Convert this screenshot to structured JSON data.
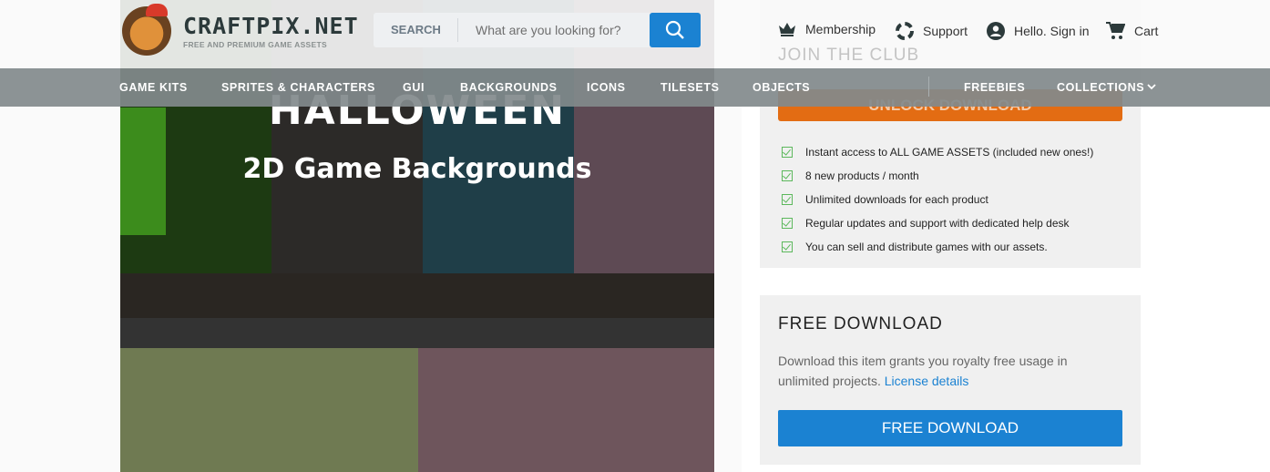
{
  "header": {
    "logo_text": "CRAFTPIX.NET",
    "logo_tagline": "FREE AND PREMIUM GAME ASSETS",
    "search": {
      "label": "SEARCH",
      "placeholder": "What are you looking for?"
    },
    "links": [
      {
        "label": "Membership",
        "icon": "crown-icon"
      },
      {
        "label": "Support",
        "icon": "lifebuoy-icon"
      },
      {
        "label": "Hello. Sign in",
        "icon": "user-circle-icon"
      },
      {
        "label": "Cart",
        "icon": "cart-icon"
      }
    ]
  },
  "nav": {
    "items": [
      "GAME KITS",
      "SPRITES & CHARACTERS",
      "GUI",
      "BACKGROUNDS",
      "ICONS",
      "TILESETS",
      "OBJECTS",
      "FREEBIES",
      "COLLECTIONS"
    ]
  },
  "hero": {
    "title": "HALLOWEEN",
    "subtitle": "2D Game Backgrounds"
  },
  "membership": {
    "title": "JOIN THE CLUB",
    "button": "UNLOCK DOWNLOAD",
    "features": [
      "Instant access to ALL GAME ASSETS (included new ones!)",
      "8 new products / month",
      "Unlimited downloads for each product",
      "Regular updates and support with dedicated help desk",
      "You can sell and distribute games with our assets."
    ],
    "check_color": "#5cb85c",
    "button_color": "#e36c13"
  },
  "free_download": {
    "title": "FREE DOWNLOAD",
    "text": "Download this item grants you royalty free usage in unlimited projects.",
    "link": "License details",
    "button": "FREE DOWNLOAD",
    "accent": "#1b82d2"
  }
}
